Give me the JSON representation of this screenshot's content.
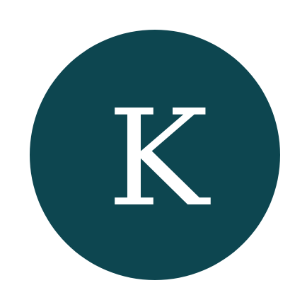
{
  "logo": {
    "letter": "K",
    "background_color": "#0d4650",
    "letter_color": "#ffffff",
    "page_background": "#ffffff"
  }
}
